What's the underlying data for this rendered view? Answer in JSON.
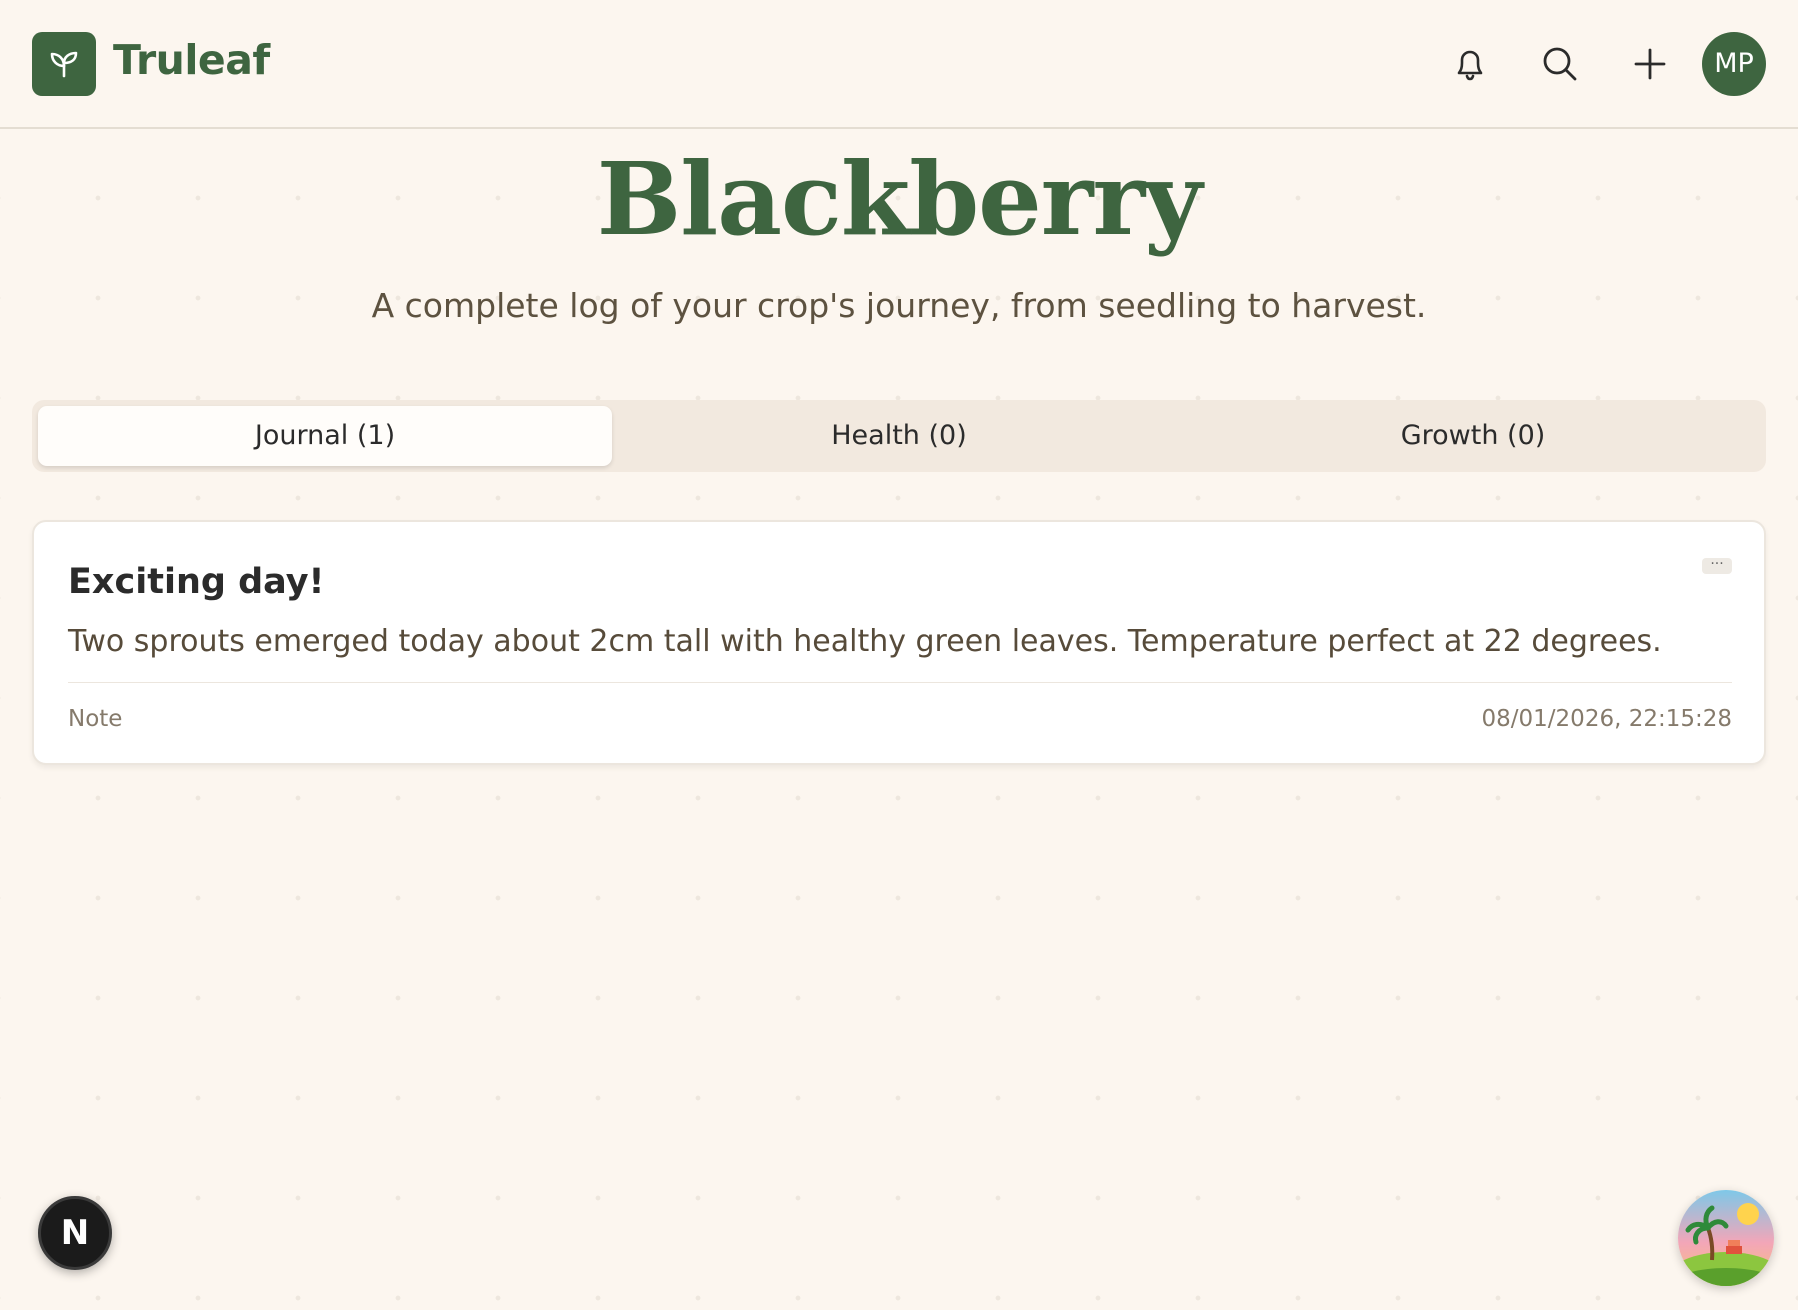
{
  "app": {
    "name": "Truleaf",
    "logo_icon": "sprout-icon",
    "brand_color": "#3e6540"
  },
  "header": {
    "icons": [
      "bell-icon",
      "search-icon",
      "plus-icon"
    ],
    "avatar_initials": "MP"
  },
  "page": {
    "title": "Blackberry",
    "subtitle": "A complete log of your crop's journey, from seedling to harvest."
  },
  "tabs": [
    {
      "label": "Journal (1)",
      "active": true
    },
    {
      "label": "Health (0)",
      "active": false
    },
    {
      "label": "Growth (0)",
      "active": false
    }
  ],
  "entries": [
    {
      "title": "Exciting day!",
      "body": "Two sprouts emerged today about 2cm tall with healthy green leaves. Temperature perfect at 22 degrees.",
      "type": "Note",
      "timestamp": "08/01/2026, 22:15:28",
      "menu_label": "···"
    }
  ],
  "floating": {
    "dev_badge": "N",
    "corner_widget_icon": "island-icon"
  }
}
